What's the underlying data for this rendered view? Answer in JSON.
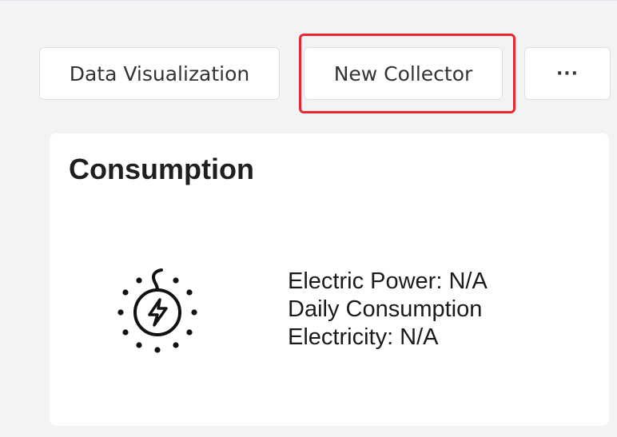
{
  "toolbar": {
    "tabs": [
      {
        "label": "Data Visualization"
      },
      {
        "label": "New Collector"
      },
      {
        "label": "···"
      }
    ]
  },
  "colors": {
    "highlight": "#e8282d",
    "page_background": "#f2f3f5",
    "card_background": "#ffffff"
  },
  "card": {
    "title": "Consumption",
    "icon": "electric-power-icon",
    "readings": {
      "line1": "Electric Power: N/A",
      "line2": "Daily Consumption",
      "line3": "Electricity: N/A"
    }
  }
}
